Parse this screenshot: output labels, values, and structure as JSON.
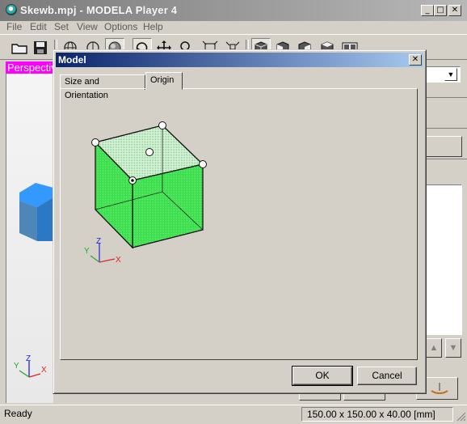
{
  "window": {
    "title": "Skewb.mpj - MODELA Player 4",
    "min_icon": "minimize-icon",
    "max_icon": "maximize-icon",
    "close_icon": "close-icon"
  },
  "menu": {
    "items": [
      "File",
      "Edit",
      "Set",
      "View",
      "Options",
      "Help"
    ]
  },
  "viewport": {
    "label": "Perspective",
    "axes": {
      "x": "X",
      "y": "Y",
      "z": "Z"
    }
  },
  "dialog": {
    "title": "Model",
    "tabs": [
      {
        "label": "Size and Orientation",
        "active": false
      },
      {
        "label": "Origin",
        "active": true
      }
    ],
    "axes": {
      "x": "X",
      "y": "Y",
      "z": "Z"
    },
    "ok_label": "OK",
    "cancel_label": "Cancel"
  },
  "status": {
    "left": "Ready",
    "dims": "150.00 x 150.00 x 40.00 [mm]"
  },
  "colors": {
    "title_start": "#0a246a",
    "title_end": "#a6caf0",
    "cube_green": "#33dd44",
    "viewport_label": "#ff00ff",
    "model_blue": "#3399ff"
  }
}
